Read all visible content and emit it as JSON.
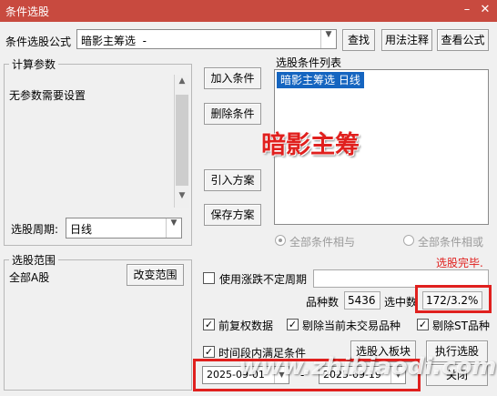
{
  "window": {
    "title": "条件选股",
    "minimize": "–",
    "close": "✕"
  },
  "formula": {
    "label": "条件选股公式",
    "value": "暗影主筹选  -",
    "find_button": "查找",
    "usage_button": "用法注释",
    "view_button": "查看公式"
  },
  "params_group": {
    "title": "计算参数",
    "message": "无参数需要设置"
  },
  "period": {
    "label": "选股周期:",
    "value": "日线"
  },
  "actions": {
    "add": "加入条件",
    "delete": "删除条件",
    "import": "引入方案",
    "save": "保存方案"
  },
  "conditions": {
    "title": "选股条件列表",
    "items": [
      "暗影主筹选  日线"
    ],
    "overlay": "暗影主筹"
  },
  "logic": {
    "and_label": "全部条件相与",
    "or_label": "全部条件相或"
  },
  "status": {
    "text": "选股完毕.",
    "color": "#e0201e"
  },
  "scope": {
    "title": "选股范围",
    "value": "全部A股",
    "change_button": "改变范围"
  },
  "unusual_period": {
    "label": "使用涨跌不定周期",
    "checked": false
  },
  "stats": {
    "count_label": "品种数",
    "count_value": "5436",
    "selected_label": "选中数",
    "selected_value": "172/3.2%"
  },
  "options": [
    {
      "label": "前复权数据",
      "checked": true
    },
    {
      "label": "剔除当前未交易品种",
      "checked": true
    },
    {
      "label": "剔除ST品种",
      "checked": true
    }
  ],
  "time_range": {
    "label": "时间段内满足条件",
    "checked": true,
    "start": "2025-09-01",
    "separator": "-",
    "end": "2025-09-19"
  },
  "bottom_buttons": {
    "to_block": "选股入板块",
    "execute": "执行选股",
    "close": "关闭"
  },
  "watermark": "www.zhibiaodi.com"
}
